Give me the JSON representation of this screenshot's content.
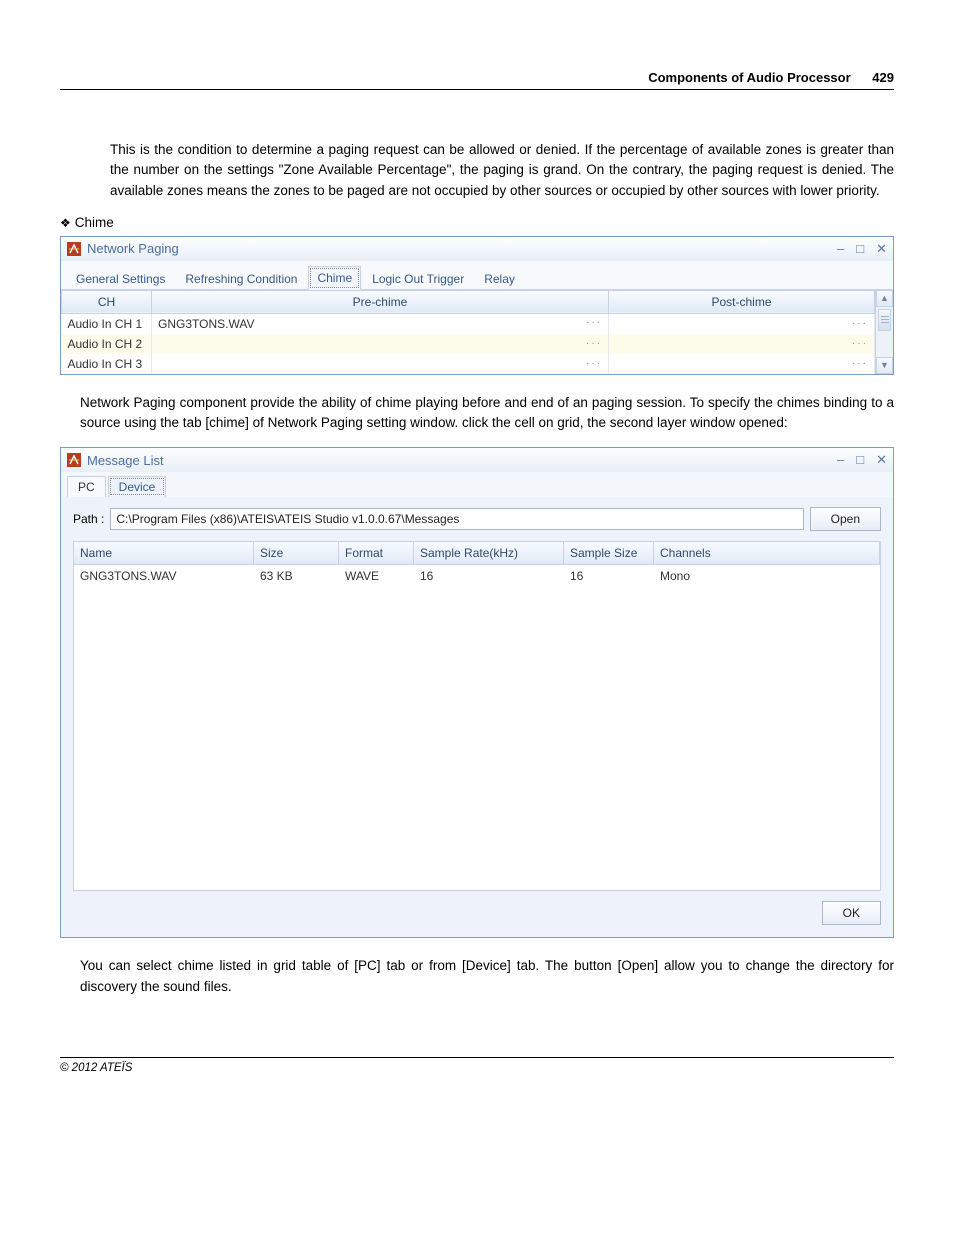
{
  "header": {
    "title": "Components of Audio Processor",
    "page": "429"
  },
  "para1": "This is the condition to determine a paging request can be allowed or denied. If the percentage of available zones is greater than the number on the settings \"Zone Available Percentage\", the paging is grand. On the contrary, the paging request is denied. The available zones means the zones to be paged are not occupied by other sources or occupied by other sources with lower priority.",
  "chime_bullet": "Chime",
  "networkPaging": {
    "title": "Network Paging",
    "tabs": [
      "General Settings",
      "Refreshing Condition",
      "Chime",
      "Logic Out Trigger",
      "Relay"
    ],
    "activeTab": 2,
    "columns": {
      "ch": "CH",
      "pre": "Pre-chime",
      "post": "Post-chime"
    },
    "rows": [
      {
        "ch": "Audio In CH 1",
        "pre": "GNG3TONS.WAV",
        "post": ""
      },
      {
        "ch": "Audio In CH 2",
        "pre": "",
        "post": ""
      },
      {
        "ch": "Audio In CH 3",
        "pre": "",
        "post": ""
      }
    ]
  },
  "para2": "Network Paging component provide the ability of chime playing before and end of an paging session. To specify the chimes binding to a source using the tab [chime] of Network Paging setting window. click the cell on grid, the second layer window opened:",
  "messageList": {
    "title": "Message List",
    "tabs": [
      "PC",
      "Device"
    ],
    "activeTab": 1,
    "pathLabel": "Path :",
    "pathValue": "C:\\Program Files (x86)\\ATEIS\\ATEIS Studio v1.0.0.67\\Messages",
    "openLabel": "Open",
    "columns": {
      "name": "Name",
      "size": "Size",
      "format": "Format",
      "sampleRate": "Sample Rate(kHz)",
      "sampleSize": "Sample Size",
      "channels": "Channels"
    },
    "rows": [
      {
        "name": "GNG3TONS.WAV",
        "size": "63 KB",
        "format": "WAVE",
        "sampleRate": "16",
        "sampleSize": "16",
        "channels": "Mono"
      }
    ],
    "okLabel": "OK"
  },
  "para3": "You can select chime listed in grid table of [PC] tab or from [Device] tab. The button [Open] allow you to change the directory for discovery the sound files.",
  "footer": "© 2012 ATEÏS",
  "glyphs": {
    "minus": "–",
    "max": "□",
    "close": "✕",
    "up": "▲",
    "down": "▼",
    "more": "···"
  }
}
